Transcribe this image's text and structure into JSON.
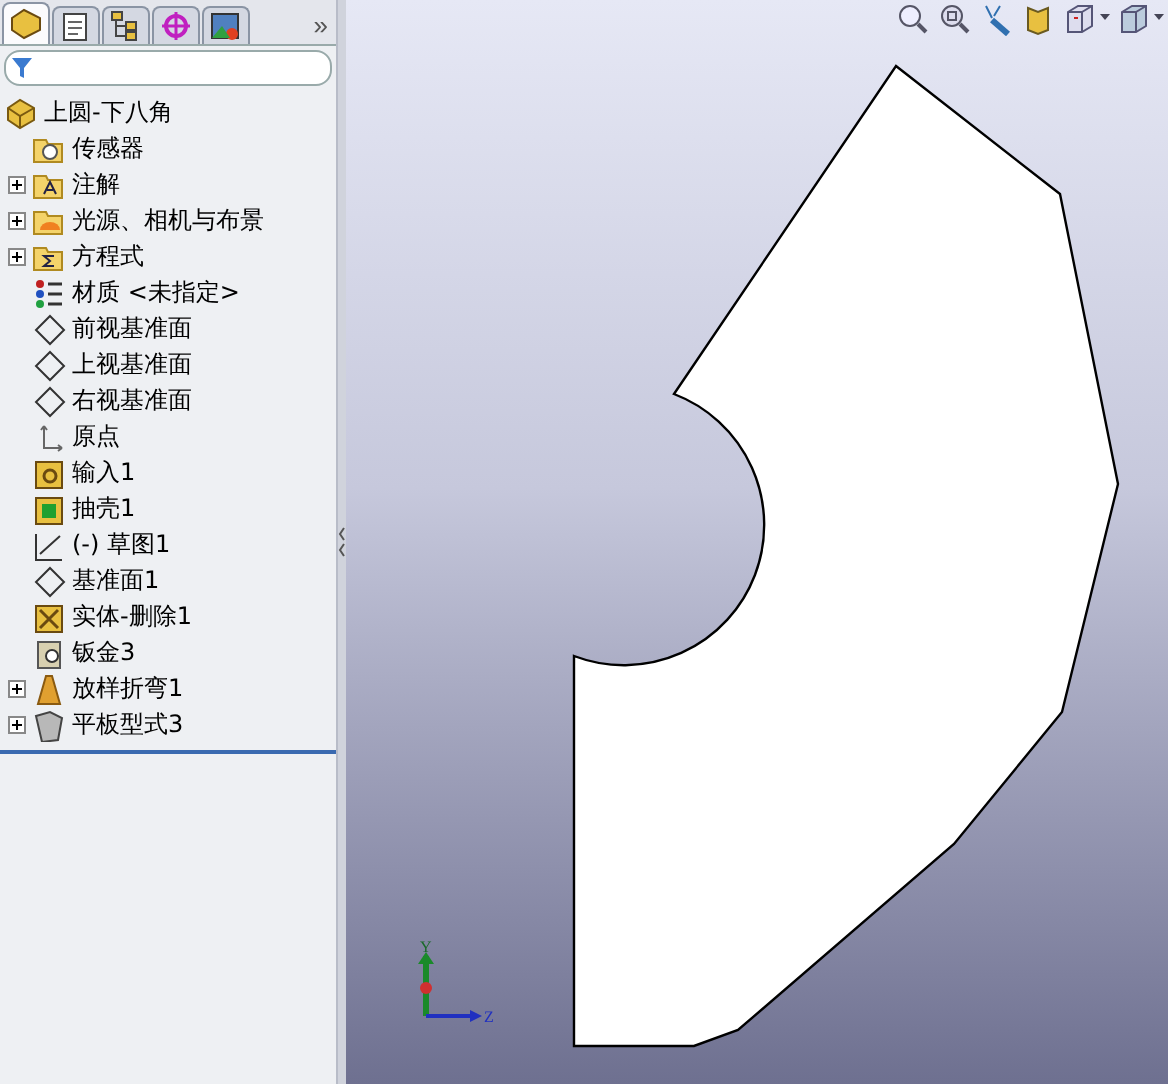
{
  "panel_tabs": [
    {
      "kind": "feature-manager",
      "selected": true
    },
    {
      "kind": "property-manager",
      "selected": false
    },
    {
      "kind": "configuration-manager",
      "selected": false
    },
    {
      "kind": "dimxpert",
      "selected": false
    },
    {
      "kind": "display-manager",
      "selected": false
    }
  ],
  "more_tabs": "»",
  "tree": {
    "label": "上圆-下八角",
    "kind": "part",
    "children": [
      {
        "label": "传感器",
        "kind": "sensor-folder",
        "expander": false
      },
      {
        "label": "注解",
        "kind": "annotation-folder",
        "expander": true
      },
      {
        "label": "光源、相机与布景",
        "kind": "light-folder",
        "expander": true
      },
      {
        "label": "方程式",
        "kind": "equation-folder",
        "expander": true
      },
      {
        "label": "材质 <未指定>",
        "kind": "material",
        "expander": false
      },
      {
        "label": "前视基准面",
        "kind": "plane",
        "expander": false
      },
      {
        "label": "上视基准面",
        "kind": "plane",
        "expander": false
      },
      {
        "label": "右视基准面",
        "kind": "plane",
        "expander": false
      },
      {
        "label": "原点",
        "kind": "origin",
        "expander": false
      },
      {
        "label": "输入1",
        "kind": "import",
        "expander": false
      },
      {
        "label": "抽壳1",
        "kind": "shell",
        "expander": false
      },
      {
        "label": "(-) 草图1",
        "kind": "sketch",
        "expander": false
      },
      {
        "label": "基准面1",
        "kind": "plane",
        "expander": false
      },
      {
        "label": "实体-删除1",
        "kind": "delete-body",
        "expander": false
      },
      {
        "label": "钣金3",
        "kind": "sheet-metal",
        "expander": false
      },
      {
        "label": "放样折弯1",
        "kind": "lofted-bend",
        "expander": true
      },
      {
        "label": "平板型式3",
        "kind": "flat-pattern",
        "expander": true
      }
    ]
  },
  "view_toolbar": [
    {
      "kind": "zoom-fit",
      "dropdown": false
    },
    {
      "kind": "zoom-area",
      "dropdown": false
    },
    {
      "kind": "previous-view",
      "dropdown": false
    },
    {
      "kind": "section-view",
      "dropdown": false
    },
    {
      "kind": "view-orientation",
      "dropdown": true
    },
    {
      "kind": "display-style",
      "dropdown": true
    }
  ],
  "triad": {
    "y_label": "Y",
    "z_label": "Z"
  }
}
